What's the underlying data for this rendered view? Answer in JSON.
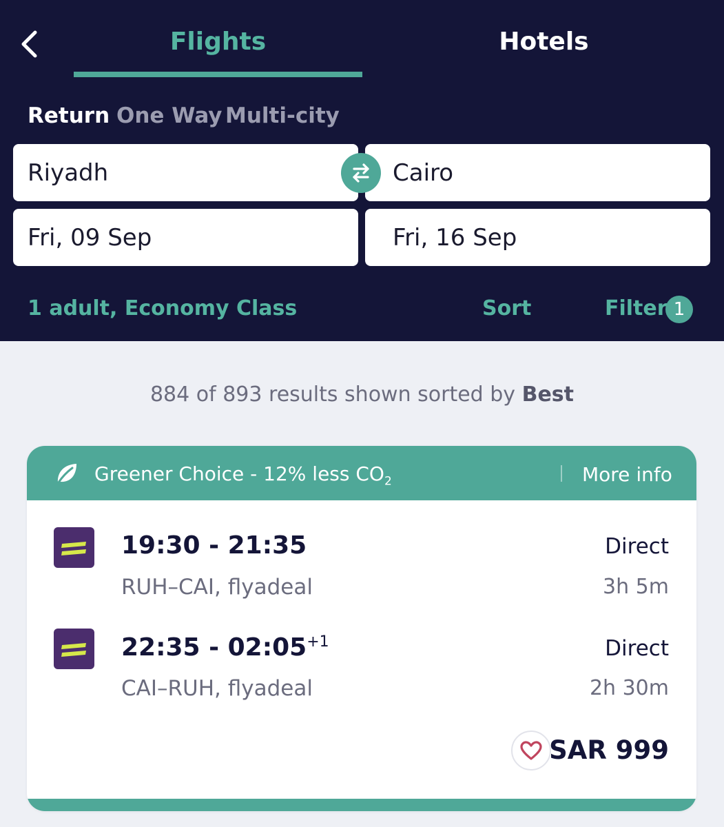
{
  "tabs": {
    "flights": "Flights",
    "hotels": "Hotels"
  },
  "trip_types": {
    "return": "Return",
    "one_way": "One Way",
    "multi_city": "Multi-city"
  },
  "search": {
    "origin": "Riyadh",
    "destination": "Cairo",
    "depart_date": "Fri, 09 Sep",
    "return_date": "Fri, 16 Sep",
    "passengers": "1 adult, Economy Class",
    "sort_label": "Sort",
    "filter_label": "Filter",
    "filter_count": "1"
  },
  "results": {
    "summary_prefix": "884 of 893 results shown sorted by ",
    "sort_by": "Best"
  },
  "result_card": {
    "banner": {
      "text": "Greener Choice - 12% less CO",
      "subscript": "2",
      "more_info": "More info"
    },
    "legs": [
      {
        "times": "19:30 - 21:35",
        "day_offset": "",
        "route": "RUH–CAI, flyadeal",
        "stops": "Direct",
        "duration": "3h 5m"
      },
      {
        "times": "22:35 - 02:05",
        "day_offset": "+1",
        "route": "CAI–RUH, flyadeal",
        "stops": "Direct",
        "duration": "2h 30m"
      }
    ],
    "price": "SAR 999"
  },
  "icons": {
    "back": "chevron-left-icon",
    "swap": "swap-arrows-icon",
    "leaf": "leaf-icon",
    "airline": "flyadeal-logo",
    "favorite": "heart-icon"
  },
  "colors": {
    "header_bg": "#141538",
    "accent": "#4fa898",
    "accent_text": "#55b4a1",
    "page_bg": "#eef0f5",
    "airline_logo_bg": "#4b2d6d",
    "airline_logo_stripe": "#d6e84a",
    "heart": "#c0455e"
  }
}
